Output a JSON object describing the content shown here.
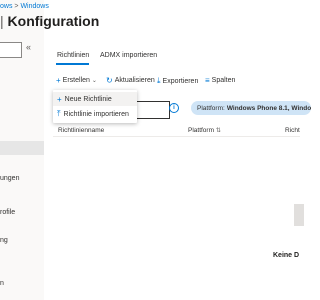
{
  "breadcrumb": {
    "item1": "ows",
    "sep": ">",
    "item2": "Windows"
  },
  "page": {
    "title_prefix": "|",
    "title": "Konfiguration"
  },
  "sidebar": {
    "search_placeholder": "",
    "collapse_glyph": "«",
    "items": [
      {
        "label": "ungen"
      },
      {
        "label": "rofile"
      },
      {
        "label": "ng"
      },
      {
        "label": "n"
      }
    ]
  },
  "tabs": [
    {
      "label": "Richtlinien",
      "selected": true
    },
    {
      "label": "ADMX importieren",
      "selected": false
    }
  ],
  "toolbar": {
    "create": "Erstellen",
    "refresh": "Aktualisieren",
    "export": "Exportieren",
    "columns": "Spalten"
  },
  "dropdown": {
    "items": [
      {
        "label": "Neue Richtlinie",
        "icon": "plus-icon"
      },
      {
        "label": "Richtlinie importieren",
        "icon": "import-icon"
      }
    ]
  },
  "filter": {
    "placeholder": "",
    "pill_label": "Plattform:",
    "pill_value": "Windows Phone 8.1, Windo"
  },
  "table": {
    "columns": [
      "Richtlinienname",
      "Plattform",
      "Richt"
    ]
  },
  "empty_state": {
    "text": "Keine D"
  },
  "colors": {
    "accent": "#0078d4",
    "pill": "#cfe4f6"
  }
}
